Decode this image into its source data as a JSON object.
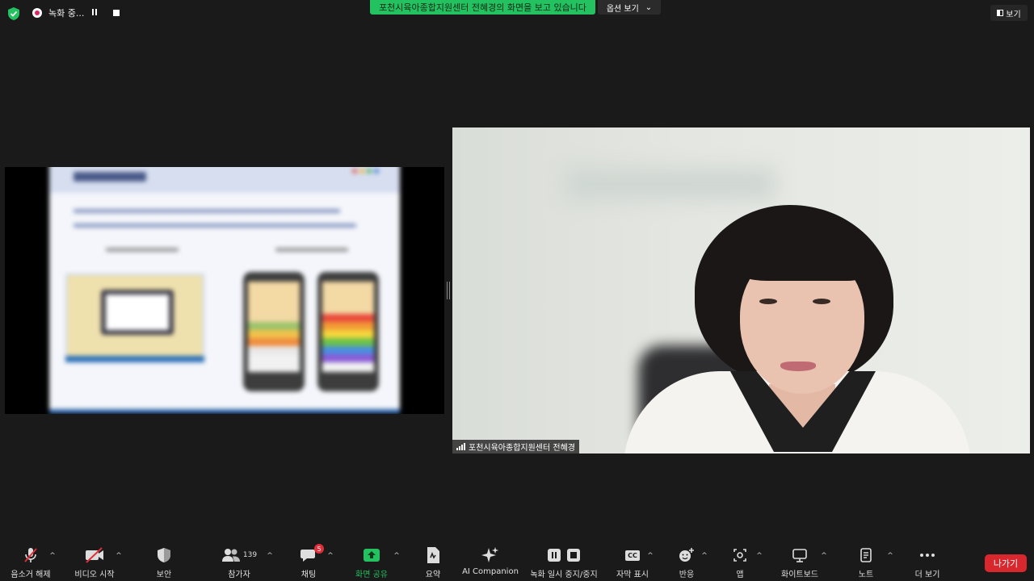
{
  "top": {
    "recording_label": "녹화 중...",
    "share_banner": "포천시육아종합지원센터 전혜경의 화면을 보고 있습니다",
    "options_label": "옵션 보기",
    "view_label": "보기"
  },
  "video": {
    "participant_name": "포천시육아종합지원센터 전혜경"
  },
  "toolbar": {
    "unmute": "음소거 해제",
    "video": "비디오 시작",
    "security": "보안",
    "participants": "참가자",
    "participants_count": "139",
    "chat": "채팅",
    "chat_badge": "5",
    "share": "화면 공유",
    "summary": "요약",
    "ai": "AI Companion",
    "record": "녹화 일시 중지/중지",
    "captions": "자막 표시",
    "reactions": "반응",
    "apps": "앱",
    "whiteboard": "화이트보드",
    "notes": "노트",
    "more": "더 보기",
    "leave": "나가기",
    "cc_text": "CC"
  },
  "colors": {
    "accent_green": "#23c15f",
    "leave_red": "#d8282e",
    "badge_red": "#e02e3a"
  }
}
